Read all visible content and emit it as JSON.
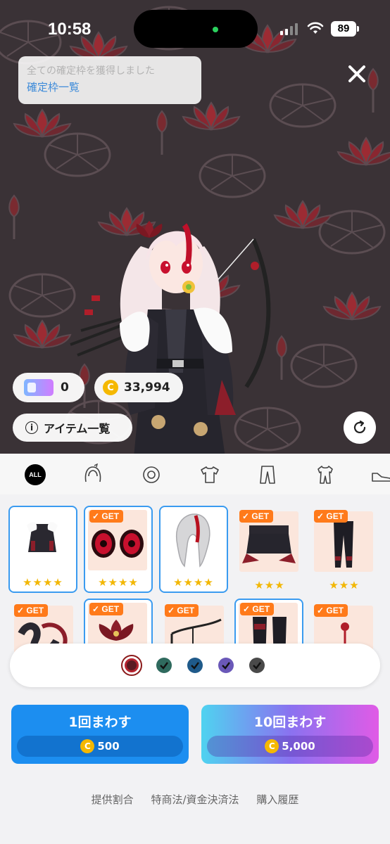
{
  "status_bar": {
    "time": "10:58",
    "battery": "89"
  },
  "notice": {
    "text": "全ての確定枠を獲得しました",
    "link": "確定枠一覧"
  },
  "wallet": {
    "tickets": "0",
    "coins": "33,994"
  },
  "item_list_label": "アイテム一覧",
  "categories": [
    "ALL",
    "hair-accessory",
    "face",
    "top",
    "bottom",
    "onepiece",
    "shoes"
  ],
  "grid": {
    "row1": [
      {
        "badge": "",
        "stars": "★★★★",
        "selected": true
      },
      {
        "badge": "GET",
        "stars": "★★★★",
        "selected": true
      },
      {
        "badge": "",
        "stars": "★★★★",
        "selected": true
      },
      {
        "badge": "GET",
        "stars": "★★★",
        "selected": false
      },
      {
        "badge": "GET",
        "stars": "★★★",
        "selected": false
      }
    ],
    "row2": [
      {
        "badge": "GET"
      },
      {
        "badge": "GET"
      },
      {
        "badge": "GET"
      },
      {
        "badge": "GET"
      },
      {
        "badge": "GET"
      }
    ]
  },
  "color_swatches": [
    "#8b1a22",
    "#2f6a5e",
    "#1f5a8a",
    "#6a58b8",
    "#4a4a4a"
  ],
  "spin": {
    "single": {
      "label": "1回まわす",
      "price": "500"
    },
    "ten": {
      "label": "10回まわす",
      "price": "5,000"
    }
  },
  "footer": {
    "rate": "提供割合",
    "law": "特商法/資金決済法",
    "history": "購入履歴"
  },
  "colors": {
    "accent_blue": "#1c8ef0",
    "get_orange": "#ff7a1a",
    "star": "#f2b705"
  }
}
